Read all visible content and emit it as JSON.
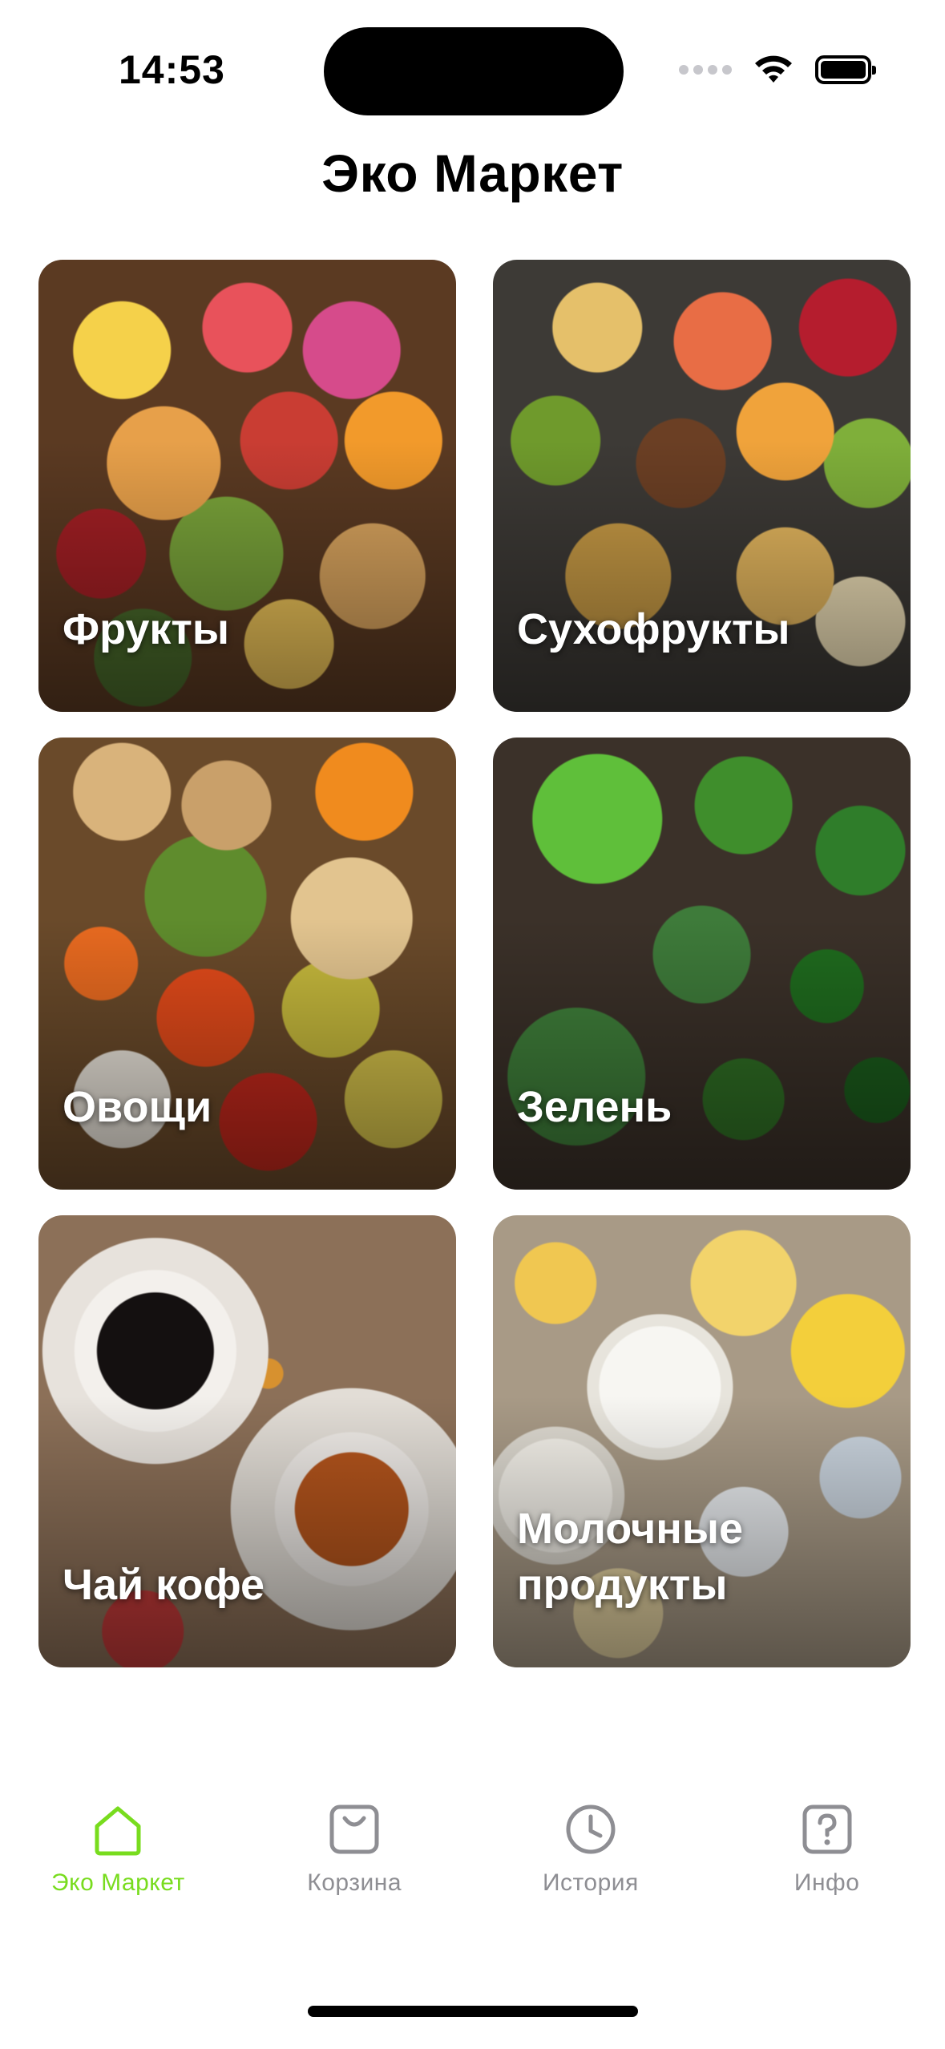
{
  "status_bar": {
    "time": "14:53"
  },
  "page": {
    "title": "Эко Маркет"
  },
  "categories": [
    {
      "label": "Фрукты"
    },
    {
      "label": "Сухофрукты"
    },
    {
      "label": "Овощи"
    },
    {
      "label": "Зелень"
    },
    {
      "label": "Чай кофе"
    },
    {
      "label": "Молочные\nпродукты"
    }
  ],
  "tabbar": {
    "items": [
      {
        "label": "Эко Маркет",
        "icon": "home-icon",
        "active": true
      },
      {
        "label": "Корзина",
        "icon": "bag-icon",
        "active": false
      },
      {
        "label": "История",
        "icon": "clock-icon",
        "active": false
      },
      {
        "label": "Инфо",
        "icon": "question-icon",
        "active": false
      }
    ]
  },
  "colors": {
    "accent": "#78dc1e",
    "inactive": "#8e8e93"
  }
}
